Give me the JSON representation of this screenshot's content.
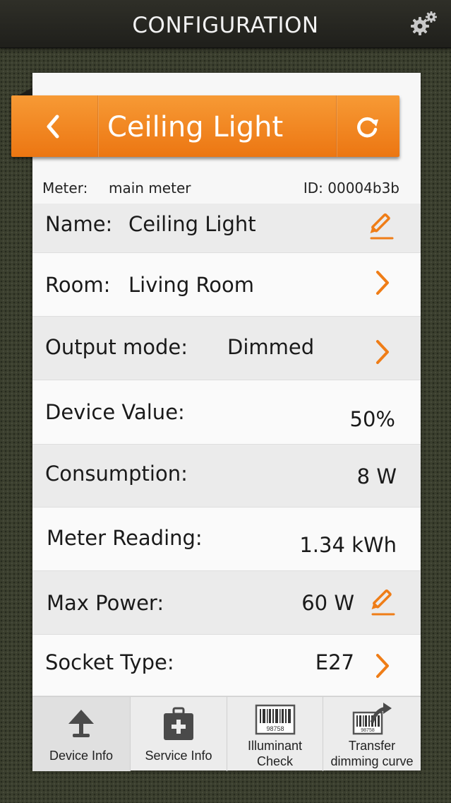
{
  "header": {
    "title": "CONFIGURATION"
  },
  "device": {
    "title": "Ceiling Light"
  },
  "meta": {
    "meter_label": "Meter:",
    "meter_value": "main meter",
    "id_text": "ID: 00004b3b"
  },
  "rows": {
    "name": {
      "label": "Name:",
      "value": "Ceiling Light"
    },
    "room": {
      "label": "Room:",
      "value": "Living Room"
    },
    "output_mode": {
      "label": "Output mode:",
      "value": "Dimmed"
    },
    "device_value": {
      "label": "Device Value:",
      "value": "50%"
    },
    "consumption": {
      "label": "Consumption:",
      "value": "8 W"
    },
    "meter_reading": {
      "label": "Meter Reading:",
      "value": "1.34 kWh"
    },
    "max_power": {
      "label": "Max Power:",
      "value": "60 W"
    },
    "socket_type": {
      "label": "Socket Type:",
      "value": "E27"
    }
  },
  "tabs": [
    {
      "label": "Device Info",
      "active": true
    },
    {
      "label": "Service Info",
      "active": false
    },
    {
      "label_line1": "Illuminant",
      "label_line2": "Check",
      "barcode_text": "98758",
      "active": false
    },
    {
      "label_line1": "Transfer",
      "label_line2": "dimming curve",
      "barcode_text": "98758",
      "active": false
    }
  ],
  "colors": {
    "accent": "#ef7d17",
    "header_bg": "#262622",
    "background": "#3b3f2e"
  }
}
